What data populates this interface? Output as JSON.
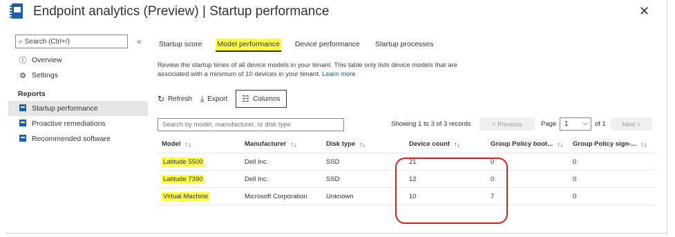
{
  "header": {
    "title": "Endpoint analytics (Preview) | Startup performance"
  },
  "sidebar": {
    "search_placeholder": "Search (Ctrl+/)",
    "collapse_label": "«",
    "items": [
      {
        "label": "Overview",
        "icon": "info-icon"
      },
      {
        "label": "Settings",
        "icon": "gear-icon"
      }
    ],
    "section_label": "Reports",
    "reports": [
      {
        "label": "Startup performance",
        "selected": true
      },
      {
        "label": "Proactive remediations",
        "selected": false
      },
      {
        "label": "Recommended software",
        "selected": false
      }
    ]
  },
  "tabs": [
    {
      "label": "Startup score",
      "active": false
    },
    {
      "label": "Model performance",
      "active": true
    },
    {
      "label": "Device performance",
      "active": false
    },
    {
      "label": "Startup processes",
      "active": false
    }
  ],
  "description": {
    "text": "Review the startup times of all device models in your tenant. This table only lists device models that are associated with a minimum of 10 devices in your tenant.",
    "link": "Learn more"
  },
  "toolbar": {
    "refresh": "Refresh",
    "export": "Export",
    "columns": "Columns"
  },
  "filter": {
    "placeholder": "Search by model, manufacturer, or disk type",
    "showing": "Showing 1 to 3 of 3 records",
    "previous": "< Previous",
    "page_label": "Page",
    "page_value": "1",
    "of_label": "of 1",
    "next": "Next >"
  },
  "table": {
    "columns": [
      "Model",
      "Manufacturer",
      "Disk type",
      "Device count",
      "Group Policy boot...",
      "Group Policy sign-..."
    ],
    "rows": [
      [
        "Latitude 5500",
        "Dell Inc.",
        "SSD",
        "21",
        "0",
        "0"
      ],
      [
        "Latitude 7390",
        "Dell Inc.",
        "SSD",
        "12",
        "0",
        "0"
      ],
      [
        "Virtual Machine",
        "Microsoft Corporation",
        "Unknown",
        "10",
        "7",
        "0"
      ]
    ]
  },
  "colors": {
    "accent": "#1f5fa8",
    "highlight": "#ffff4a",
    "annotation": "#d81b1b",
    "link": "#0063b1"
  }
}
